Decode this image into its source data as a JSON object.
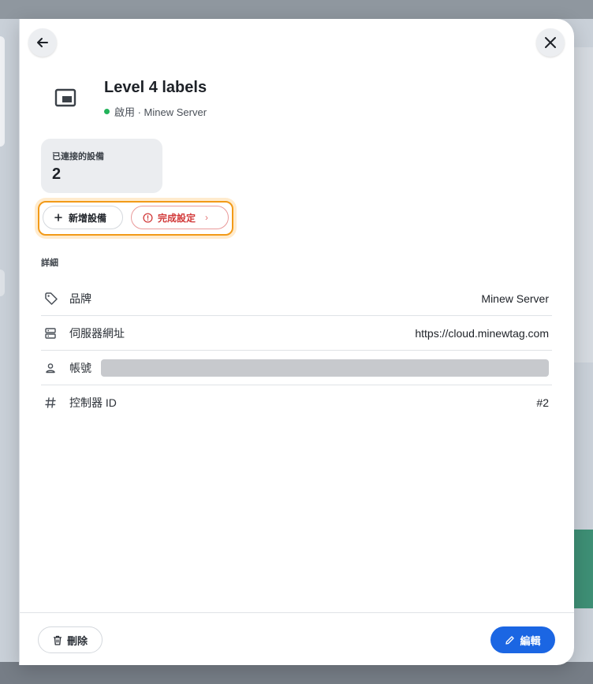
{
  "header": {
    "title": "Level 4 labels",
    "status_text": "啟用 · Minew Server"
  },
  "stats": {
    "connected_label": "已連接的設備",
    "connected_value": "2"
  },
  "actions": {
    "add_device_label": "新增設備",
    "finish_setup_label": "完成設定"
  },
  "details": {
    "section_title": "詳細",
    "rows": [
      {
        "label": "品牌",
        "value": "Minew Server",
        "icon": "tag-icon"
      },
      {
        "label": "伺服器網址",
        "value": "https://cloud.minewtag.com",
        "icon": "server-icon"
      },
      {
        "label": "帳號",
        "value": "",
        "icon": "user-icon"
      },
      {
        "label": "控制器 ID",
        "value": "#2",
        "icon": "hash-icon"
      }
    ]
  },
  "footer": {
    "delete_label": "刪除",
    "edit_label": "編輯"
  },
  "colors": {
    "accent": "#1b66e3",
    "status_active": "#22b35a",
    "warning": "#d23b3b",
    "highlight": "#f29a18"
  }
}
